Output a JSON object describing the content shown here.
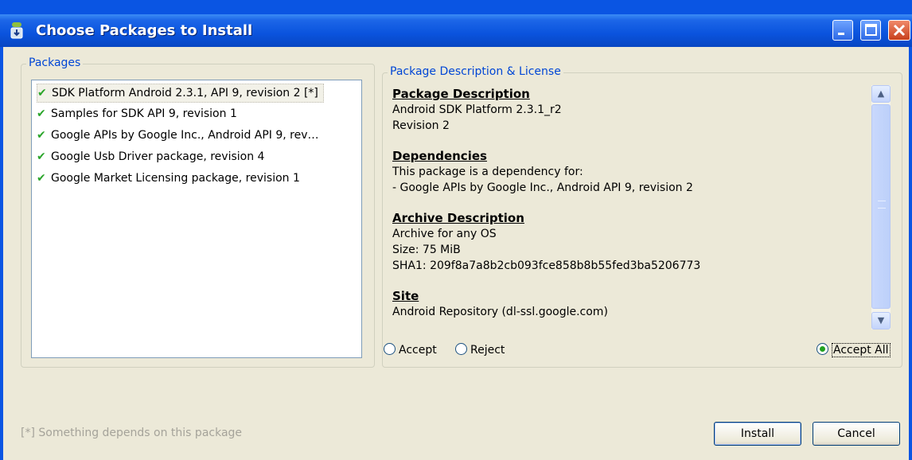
{
  "window": {
    "title": "Choose Packages to Install",
    "icon": "android-download-icon"
  },
  "packages": {
    "group_label": "Packages",
    "items": [
      {
        "label": "SDK Platform Android 2.3.1, API 9, revision 2 [*]",
        "accepted": true,
        "selected": true
      },
      {
        "label": "Samples for SDK API 9, revision 1",
        "accepted": true,
        "selected": false
      },
      {
        "label": "Google APIs by Google Inc., Android API 9, rev…",
        "accepted": true,
        "selected": false
      },
      {
        "label": "Google Usb Driver package, revision 4",
        "accepted": true,
        "selected": false
      },
      {
        "label": "Google Market Licensing package, revision 1",
        "accepted": true,
        "selected": false
      }
    ]
  },
  "description": {
    "group_label": "Package Description & License",
    "sections": [
      {
        "heading": "Package Description",
        "lines": [
          "Android SDK Platform 2.3.1_r2",
          "Revision 2"
        ]
      },
      {
        "heading": "Dependencies",
        "lines": [
          "This package is a dependency for:",
          "- Google APIs by Google Inc., Android API 9, revision 2"
        ]
      },
      {
        "heading": "Archive Description",
        "lines": [
          "Archive for any OS",
          "Size: 75 MiB",
          "SHA1: 209f8a7a8b2cb093fce858b8b55fed3ba5206773"
        ]
      },
      {
        "heading": "Site",
        "lines": [
          "Android Repository (dl-ssl.google.com)"
        ]
      }
    ]
  },
  "license": {
    "accept_label": "Accept",
    "reject_label": "Reject",
    "accept_all_label": "Accept All",
    "selected": "accept_all"
  },
  "footer": {
    "note": "[*] Something depends on this package",
    "install_label": "Install",
    "cancel_label": "Cancel"
  },
  "colors": {
    "titlebar": "#0a53dd",
    "dialog_bg": "#ece9d8",
    "group_label": "#0046d5",
    "check": "#2aa52a"
  }
}
